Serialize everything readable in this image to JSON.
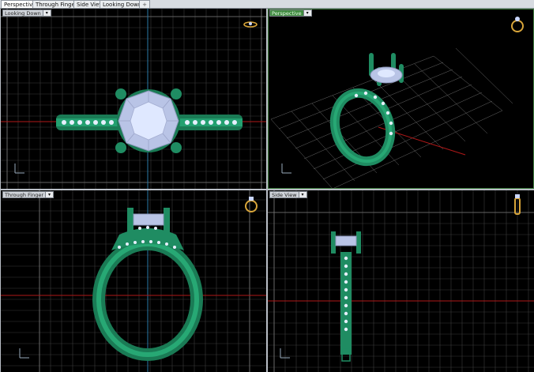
{
  "tabs": [
    {
      "label": "Perspective",
      "active": true
    },
    {
      "label": "Through Finger",
      "active": false
    },
    {
      "label": "Side View",
      "active": false
    },
    {
      "label": "Looking Down",
      "active": false
    }
  ],
  "add_tab_glyph": "+",
  "viewports": [
    {
      "label": "Looking Down",
      "dropdown_glyph": "▾"
    },
    {
      "label": "Perspective",
      "dropdown_glyph": "▾"
    },
    {
      "label": "Through Finger",
      "dropdown_glyph": "▾"
    },
    {
      "label": "Side View",
      "dropdown_glyph": "▾"
    }
  ],
  "colors": {
    "viewport_bg": "#000000",
    "grid_minor": "#3c3c3c",
    "grid_major": "#7a7a7a",
    "x_axis": "#b01818",
    "y_axis": "#2a7aa8",
    "metal": "#1f8c62",
    "stone": "#b4c0e0",
    "diamond": "#dfe8ff",
    "active_label": "#3f8a3f"
  },
  "icons": {
    "view_cube": "ring-orientation-icon",
    "axes": "axis-triad-icon"
  }
}
